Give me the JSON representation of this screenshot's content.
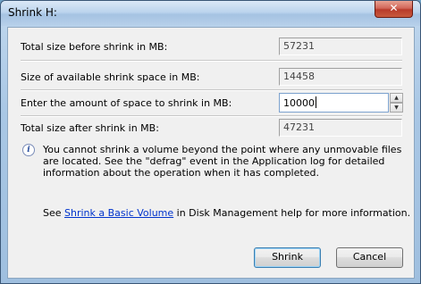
{
  "window": {
    "title": "Shrink H:",
    "close_glyph": "✕"
  },
  "fields": {
    "total_before": {
      "label": "Total size before shrink in MB:",
      "value": "57231"
    },
    "available": {
      "label": "Size of available shrink space in MB:",
      "value": "14458"
    },
    "amount": {
      "label": "Enter the amount of space to shrink in MB:",
      "value": "10000"
    },
    "total_after": {
      "label": "Total size after shrink in MB:",
      "value": "47231"
    }
  },
  "info": {
    "icon": "info-icon",
    "text": "You cannot shrink a volume beyond the point where any unmovable files are located. See the \"defrag\" event in the Application log for detailed information about the operation when it has completed."
  },
  "help": {
    "prefix": "See ",
    "link": "Shrink a Basic Volume",
    "suffix": " in Disk Management help for more information."
  },
  "buttons": {
    "shrink": "Shrink",
    "cancel": "Cancel"
  }
}
